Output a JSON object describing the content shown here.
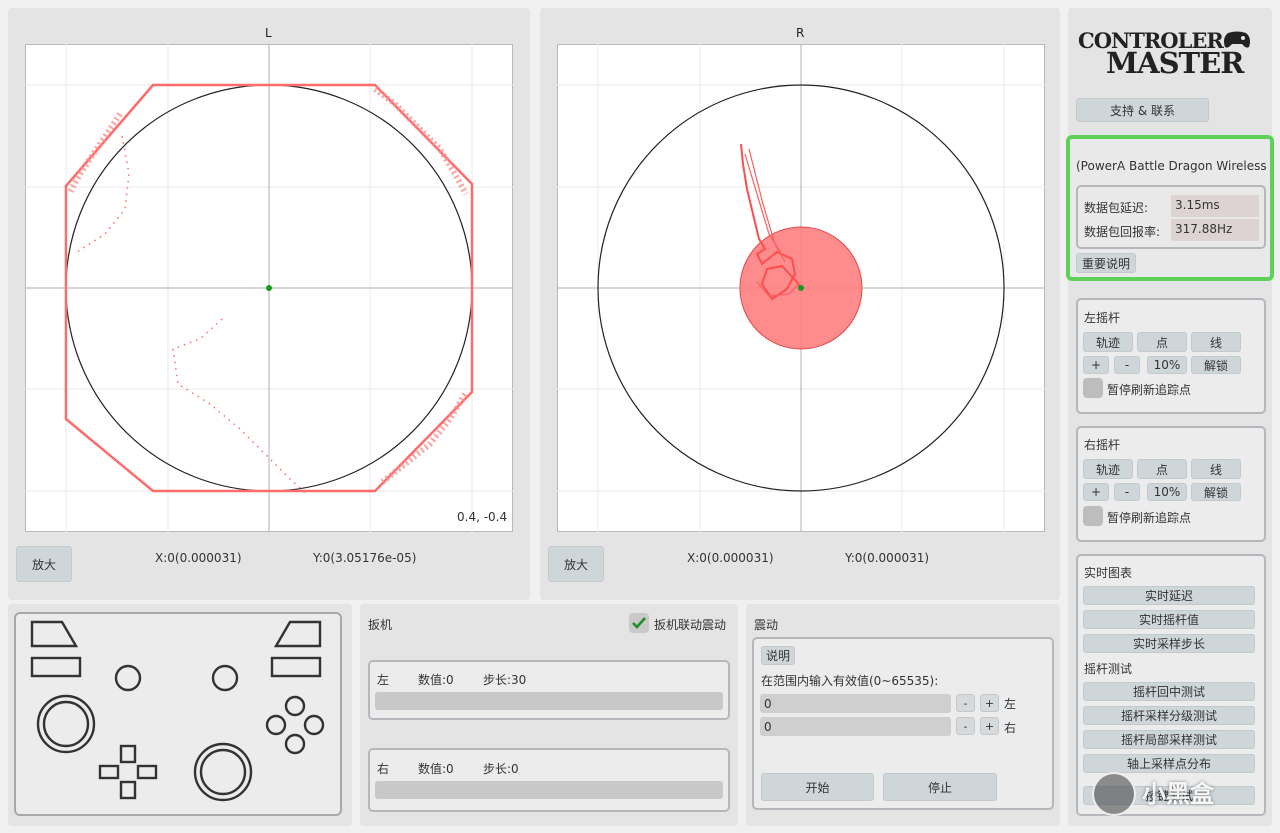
{
  "plots": {
    "left": {
      "title": "L",
      "corner_readout": "0.4, -0.4",
      "zoom_label": "放大",
      "x_readout": "X:0(0.000031)",
      "y_readout": "Y:0(3.05176e-05)"
    },
    "right": {
      "title": "R",
      "zoom_label": "放大",
      "x_readout": "X:0(0.000031)",
      "y_readout": "Y:0(0.000031)"
    }
  },
  "sidebar": {
    "logo_line1": "CONTROLER",
    "logo_line2": "MASTER",
    "support_label": "支持 & 联系",
    "device_name": "(PowerA Battle Dragon Wireless C",
    "latency_label": "数据包延迟:",
    "latency_value": "3.15ms",
    "rate_label": "数据包回报率:",
    "rate_value": "317.88Hz",
    "notes_label": "重要说明",
    "highlight_color": "#5fd15a",
    "left_stick": {
      "title": "左摇杆",
      "trail": "轨迹",
      "dot": "点",
      "line": "线",
      "plus": "+",
      "minus": "-",
      "percent": "10%",
      "unlock": "解锁",
      "pause": "暂停刷新追踪点"
    },
    "right_stick": {
      "title": "右摇杆",
      "trail": "轨迹",
      "dot": "点",
      "line": "线",
      "plus": "+",
      "minus": "-",
      "percent": "10%",
      "unlock": "解锁",
      "pause": "暂停刷新追踪点"
    },
    "realtime": {
      "title": "实时图表",
      "latency": "实时延迟",
      "stick_value": "实时摇杆值",
      "sample_step": "实时采样步长"
    },
    "stick_test": {
      "title": "摇杆测试",
      "center": "摇杆回中测试",
      "grading": "摇杆采样分级测试",
      "local": "摇杆局部采样测试",
      "axis_dist": "轴上采样点分布",
      "last": "按键测试"
    }
  },
  "triggers": {
    "title": "扳机",
    "link_label": "扳机联动震动",
    "left": {
      "side": "左",
      "value": "数值:0",
      "step": "步长:30"
    },
    "right": {
      "side": "右",
      "value": "数值:0",
      "step": "步长:0"
    }
  },
  "vibration": {
    "title": "震动",
    "explain": "说明",
    "hint": "在范围内输入有效值(0~65535):",
    "left_value": "0",
    "right_value": "0",
    "minus": "-",
    "plus": "+",
    "left_side": "左",
    "right_side": "右",
    "start": "开始",
    "stop": "停止"
  },
  "watermark": "小黑盒",
  "colors": {
    "trace": "#ff6b6b",
    "circle_fill": "#ff8080",
    "center_dot": "#1a9a1a"
  }
}
